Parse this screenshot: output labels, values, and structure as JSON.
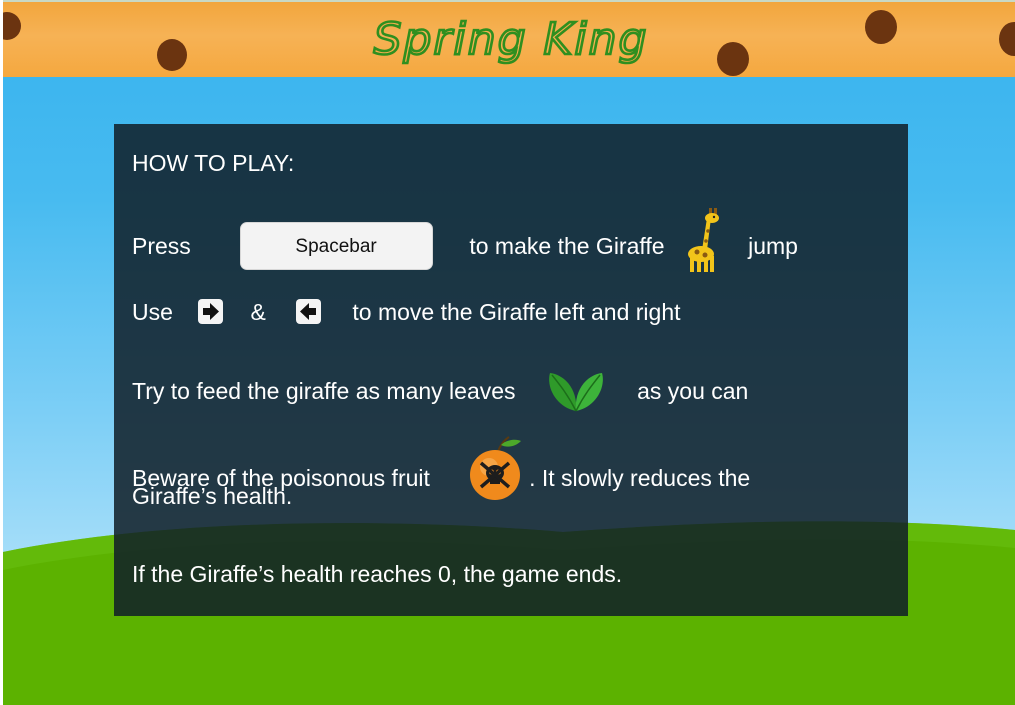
{
  "game": {
    "title": "Spring King"
  },
  "instructions": {
    "heading": "HOW TO PLAY:",
    "line1": {
      "prefix": "Press",
      "key_label": "Spacebar",
      "middle": "to make the Giraffe",
      "suffix": "jump"
    },
    "line2": {
      "prefix": "Use",
      "connector": "&",
      "suffix": "to move the Giraffe left and right"
    },
    "line3": {
      "prefix": "Try to feed the giraffe as many leaves",
      "suffix": "as you can"
    },
    "line4": {
      "prefix": "Beware of the poisonous fruit",
      "suffix": ". It slowly reduces the",
      "continuation": "Giraffe’s health."
    },
    "line5": "If the Giraffe’s health reaches 0, the game ends."
  },
  "icons": {
    "giraffe": "giraffe-icon",
    "right_arrow": "right-arrow-key-icon",
    "left_arrow": "left-arrow-key-icon",
    "leaves": "leaves-icon",
    "poison_fruit": "poison-fruit-icon"
  },
  "colors": {
    "sky": "#36b2ee",
    "grass": "#5cb200",
    "top_bar": "#f5a83f",
    "title_green": "#2f8f1f",
    "panel": "#1a2a36",
    "dots": "#6b3410"
  }
}
